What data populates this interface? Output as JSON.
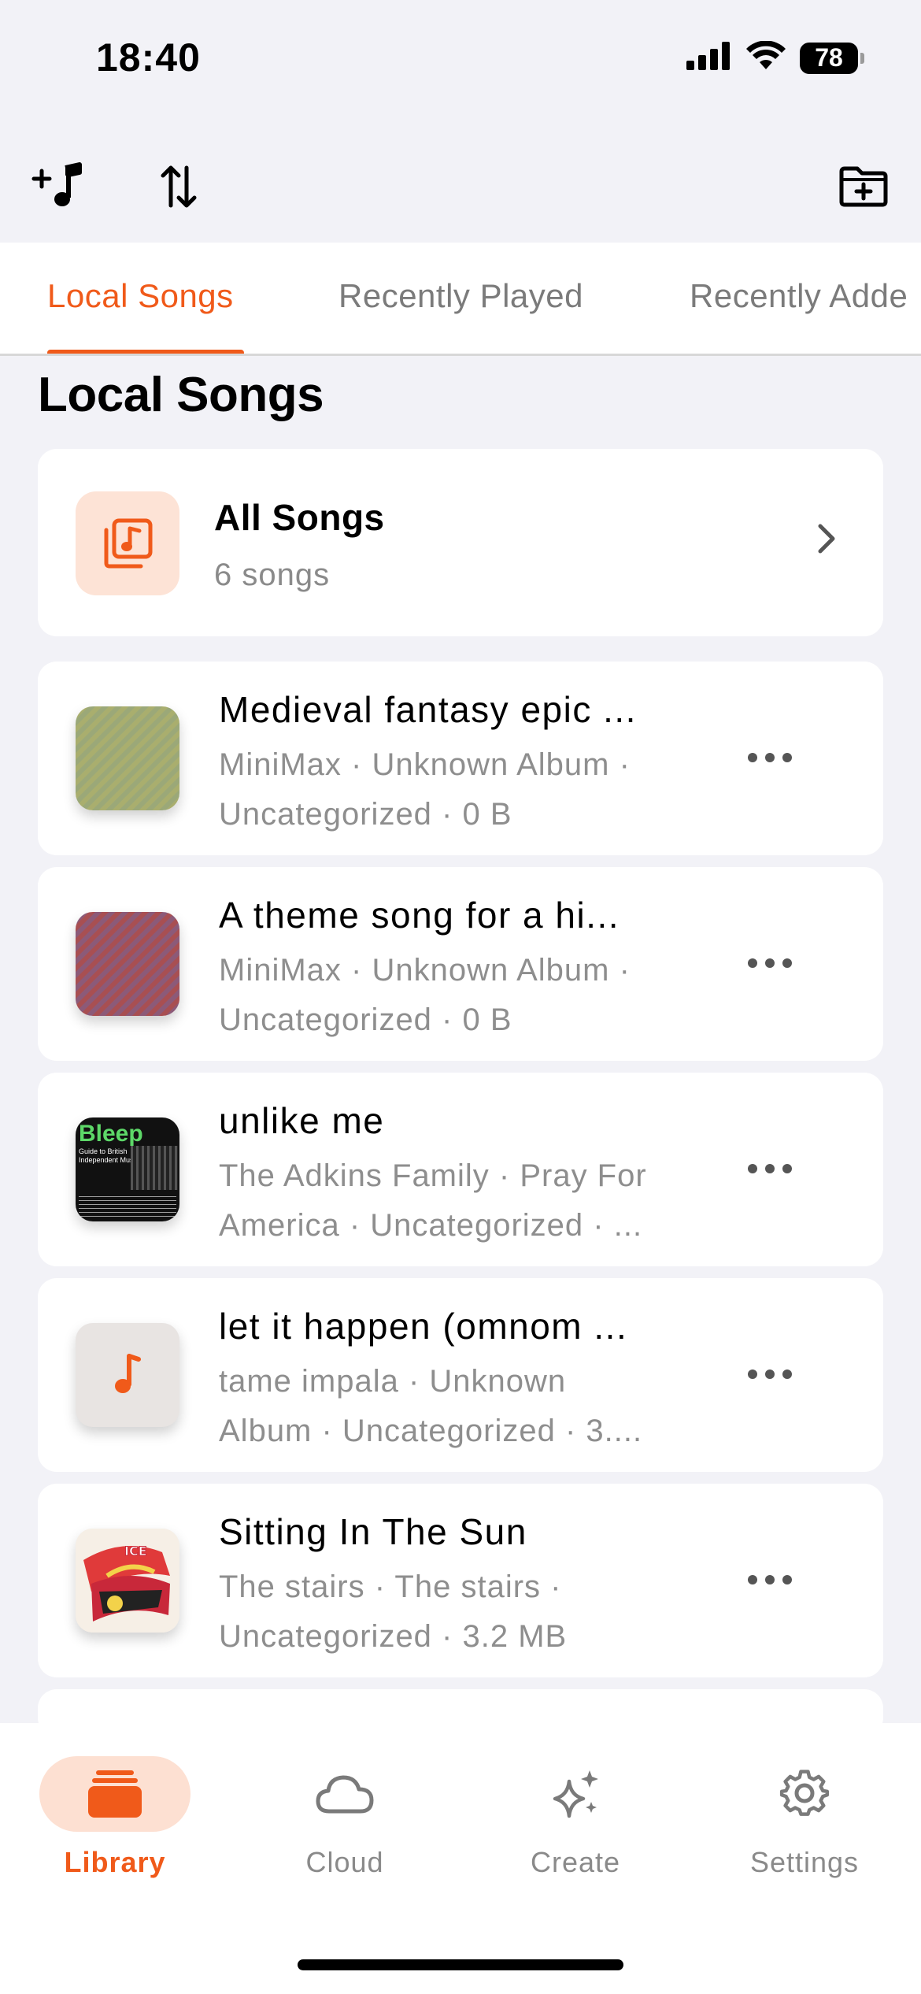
{
  "status_bar": {
    "time": "18:40",
    "battery": "78",
    "icons": [
      "signal-icon",
      "wifi-icon",
      "battery-icon"
    ]
  },
  "toolbar": {
    "icons": [
      "add-music-icon",
      "sort-icon",
      "new-folder-icon"
    ]
  },
  "tabs": [
    {
      "label": "Local Songs",
      "active": true
    },
    {
      "label": "Recently Played",
      "active": false
    },
    {
      "label": "Recently Adde",
      "active": false
    }
  ],
  "section_title": "Local Songs",
  "all_songs": {
    "title": "All Songs",
    "subtitle": "6 songs",
    "icon": "music-library-icon"
  },
  "songs": [
    {
      "title": "Medieval fantasy epic ...",
      "meta": "MiniMax · Unknown Album · Uncategorized · 0 B",
      "art": "green-gradient"
    },
    {
      "title": "A theme song for a hi...",
      "meta": "MiniMax · Unknown Album · Uncategorized · 0 B",
      "art": "red-purple-gradient"
    },
    {
      "title": "unlike me",
      "meta": "The Adkins Family · Pray For America · Uncategorized · ...",
      "art": "bleep-cover",
      "art_text": "Bleep",
      "art_sub": "Guide to British Independent Music"
    },
    {
      "title": "let it happen (omnom ...",
      "meta": "tame impala · Unknown Album · Uncategorized · 3....",
      "art": "placeholder-note"
    },
    {
      "title": "Sitting In The Sun",
      "meta": "The stairs · The stairs · Uncategorized · 3.2 MB",
      "art": "stairs-cover"
    }
  ],
  "bottom_nav": [
    {
      "label": "Library",
      "icon": "library-icon",
      "active": true
    },
    {
      "label": "Cloud",
      "icon": "cloud-icon",
      "active": false
    },
    {
      "label": "Create",
      "icon": "sparkles-icon",
      "active": false
    },
    {
      "label": "Settings",
      "icon": "gear-icon",
      "active": false
    }
  ],
  "colors": {
    "accent": "#f05a1a",
    "accent_light": "#fde0d2",
    "background": "#f2f2f7"
  }
}
